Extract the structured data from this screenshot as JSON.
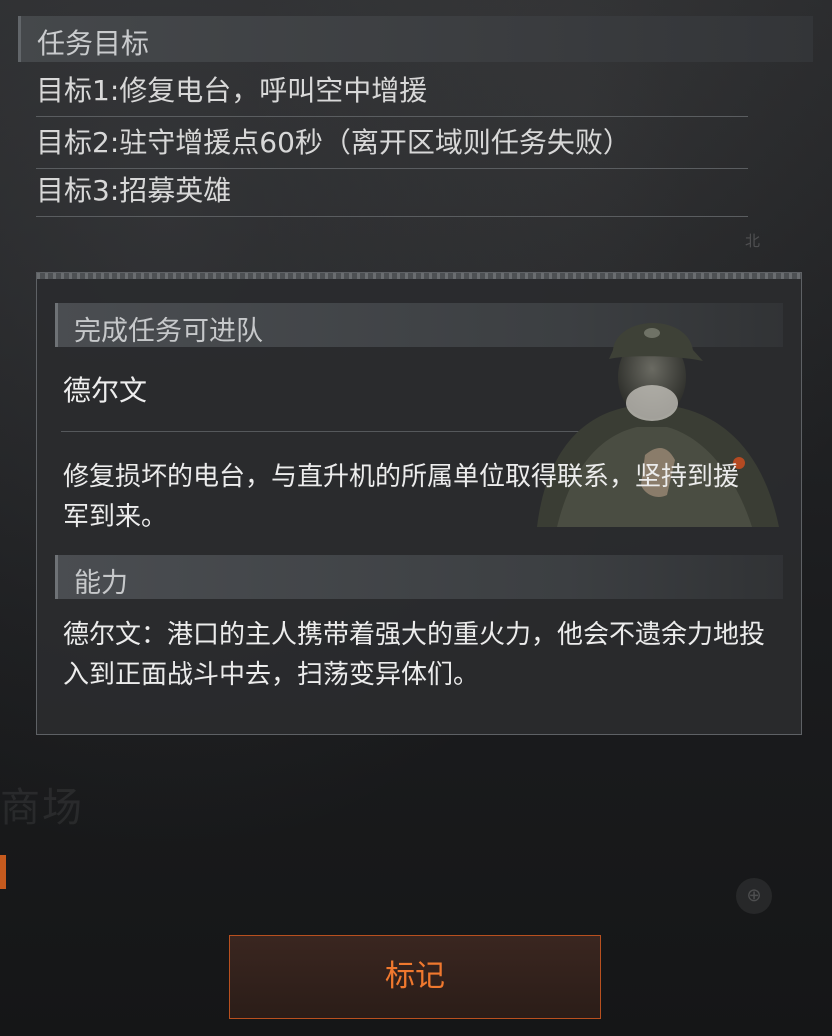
{
  "mission": {
    "title": "任务目标",
    "objectives": [
      "目标1:修复电台，呼叫空中增援",
      "目标2:驻守增援点60秒（离开区域则任务失败）",
      "目标3:招募英雄"
    ]
  },
  "hero_card": {
    "join_label": "完成任务可进队",
    "hero_name": "德尔文",
    "description": "修复损坏的电台，与直升机的所属单位取得联系，坚持到援军到来。",
    "ability_label": "能力",
    "ability_text": "德尔文：港口的主人携带着强大的重火力，他会不遗余力地投入到正面战斗中去，扫荡变异体们。",
    "portrait_icon": "soldier-portrait"
  },
  "map": {
    "watermark": "商场",
    "north": "北"
  },
  "actions": {
    "mark_label": "标记"
  },
  "colors": {
    "accent": "#f0782e",
    "button_border": "#b8501f"
  }
}
